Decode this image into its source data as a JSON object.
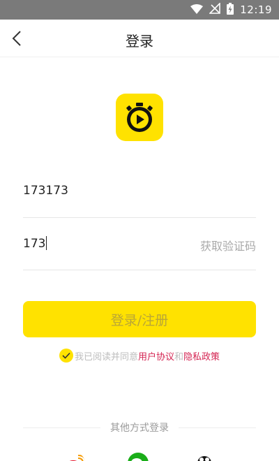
{
  "status_bar": {
    "time": "12:19"
  },
  "nav": {
    "title": "登录"
  },
  "form": {
    "phone_value": "173173",
    "code_value": "173",
    "get_code_label": "获取验证码",
    "submit_label": "登录/注册"
  },
  "agreement": {
    "prefix": "我已阅读并同意",
    "user_agreement": "用户协议",
    "connector": "和",
    "privacy_policy": "隐私政策"
  },
  "other_login": {
    "label": "其他方式登录"
  },
  "colors": {
    "accent": "#ffe200",
    "link": "#d42452",
    "status_bar": "#7a7a7a"
  }
}
